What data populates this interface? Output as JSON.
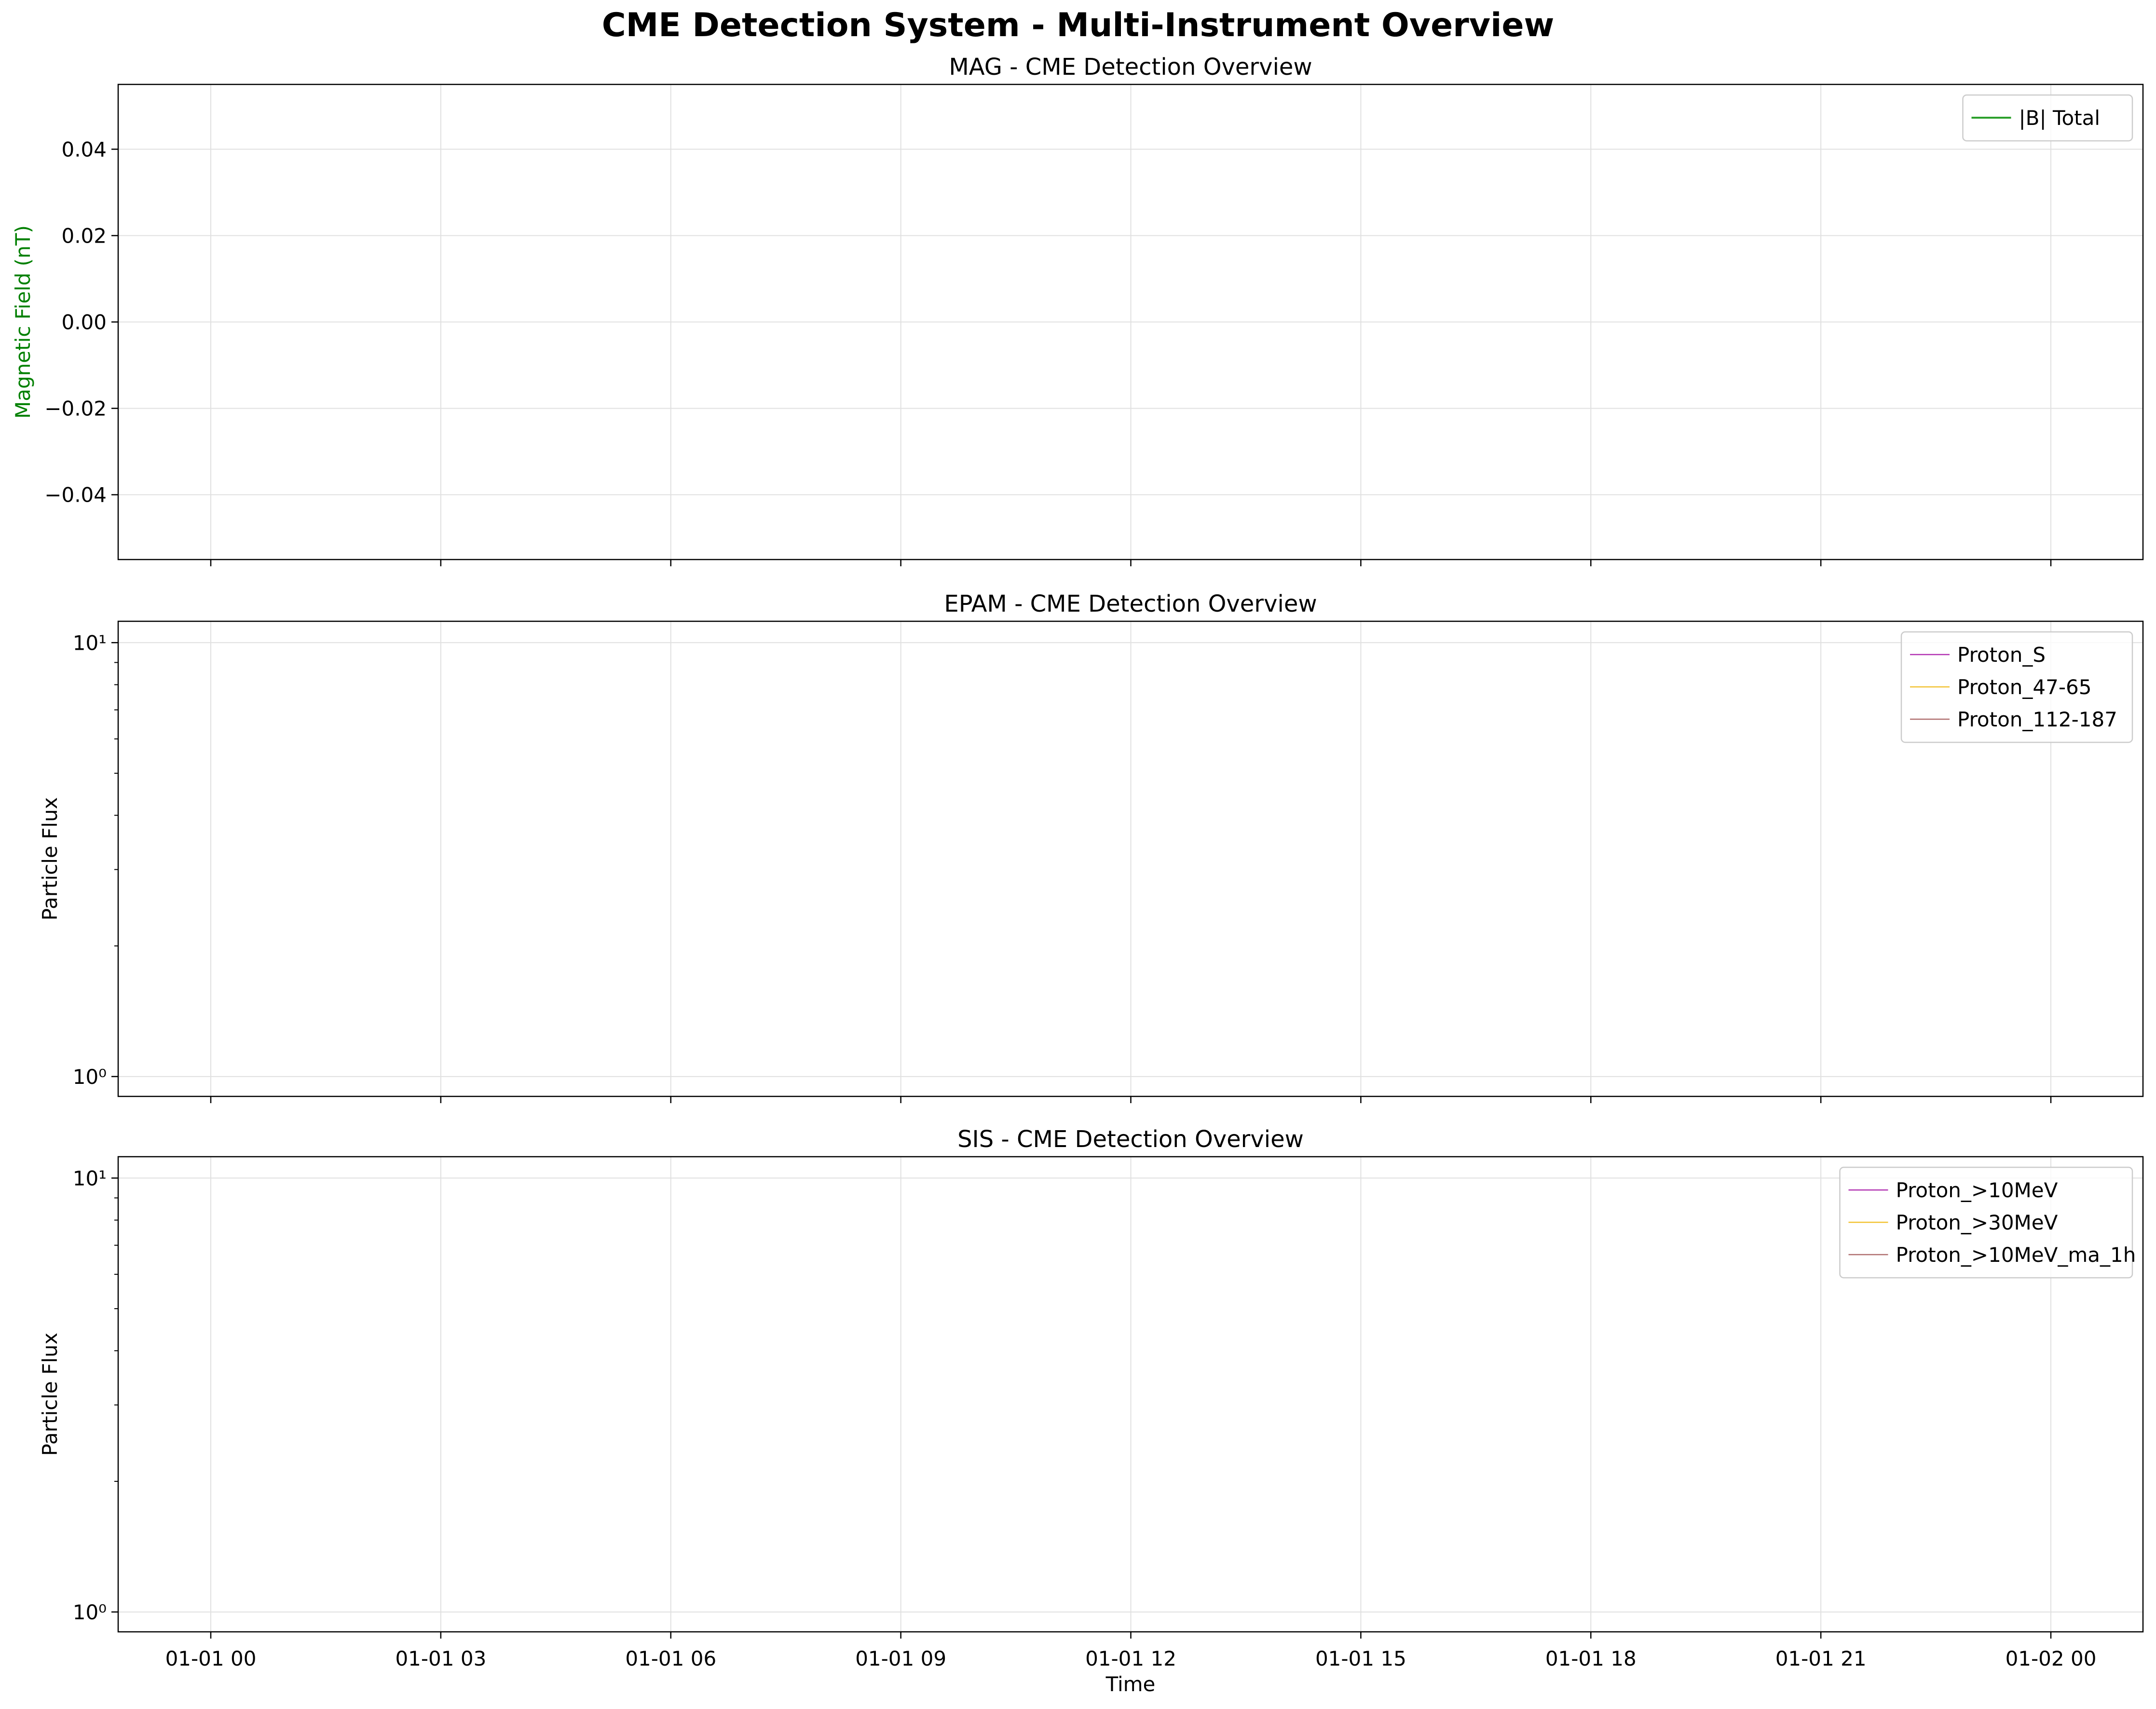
{
  "figure_title": "CME Detection System - Multi-Instrument Overview",
  "colors": {
    "mag_line": "#2ca02c",
    "mag_ylabel": "#008000",
    "magenta": "#b233b2",
    "gold": "#f2c232",
    "rosy": "#b07070",
    "grid": "#e0e0e0",
    "axis": "#000000"
  },
  "chart_data": [
    {
      "type": "line",
      "title": "MAG - CME Detection Overview",
      "ylabel": "Magnetic Field (nT)",
      "xlabel": "",
      "yscale": "linear",
      "ylim": [
        -0.055,
        0.055
      ],
      "yticks": [
        -0.04,
        -0.02,
        0.0,
        0.02,
        0.04
      ],
      "ytick_labels": [
        "−0.04",
        "−0.02",
        "0.00",
        "0.02",
        "0.04"
      ],
      "xticks": [
        "01-01 00",
        "01-01 03",
        "01-01 06",
        "01-01 09",
        "01-01 12",
        "01-01 15",
        "01-01 18",
        "01-01 21",
        "01-02 00"
      ],
      "show_xtick_labels": false,
      "grid": true,
      "legend_position": "top-right",
      "series": [
        {
          "name": "|B| Total",
          "color": "#2ca02c",
          "values": []
        }
      ]
    },
    {
      "type": "line",
      "title": "EPAM - CME Detection Overview",
      "ylabel": "Particle Flux",
      "xlabel": "",
      "yscale": "log",
      "ylim": [
        0.9,
        11.2
      ],
      "ytick_labels": [
        "10⁰",
        "10¹"
      ],
      "xticks": [
        "01-01 00",
        "01-01 03",
        "01-01 06",
        "01-01 09",
        "01-01 12",
        "01-01 15",
        "01-01 18",
        "01-01 21",
        "01-02 00"
      ],
      "show_xtick_labels": false,
      "grid": true,
      "legend_position": "top-right",
      "series": [
        {
          "name": "Proton_S",
          "color": "#b233b2",
          "values": []
        },
        {
          "name": "Proton_47-65",
          "color": "#f2c232",
          "values": []
        },
        {
          "name": "Proton_112-187",
          "color": "#b07070",
          "values": []
        }
      ]
    },
    {
      "type": "line",
      "title": "SIS - CME Detection Overview",
      "ylabel": "Particle Flux",
      "xlabel": "Time",
      "yscale": "log",
      "ylim": [
        0.9,
        11.2
      ],
      "ytick_labels": [
        "10⁰",
        "10¹"
      ],
      "xticks": [
        "01-01 00",
        "01-01 03",
        "01-01 06",
        "01-01 09",
        "01-01 12",
        "01-01 15",
        "01-01 18",
        "01-01 21",
        "01-02 00"
      ],
      "show_xtick_labels": true,
      "grid": true,
      "legend_position": "top-right",
      "series": [
        {
          "name": "Proton_>10MeV",
          "color": "#b233b2",
          "values": []
        },
        {
          "name": "Proton_>30MeV",
          "color": "#f2c232",
          "values": []
        },
        {
          "name": "Proton_>10MeV_ma_1h",
          "color": "#b07070",
          "values": []
        }
      ]
    }
  ]
}
